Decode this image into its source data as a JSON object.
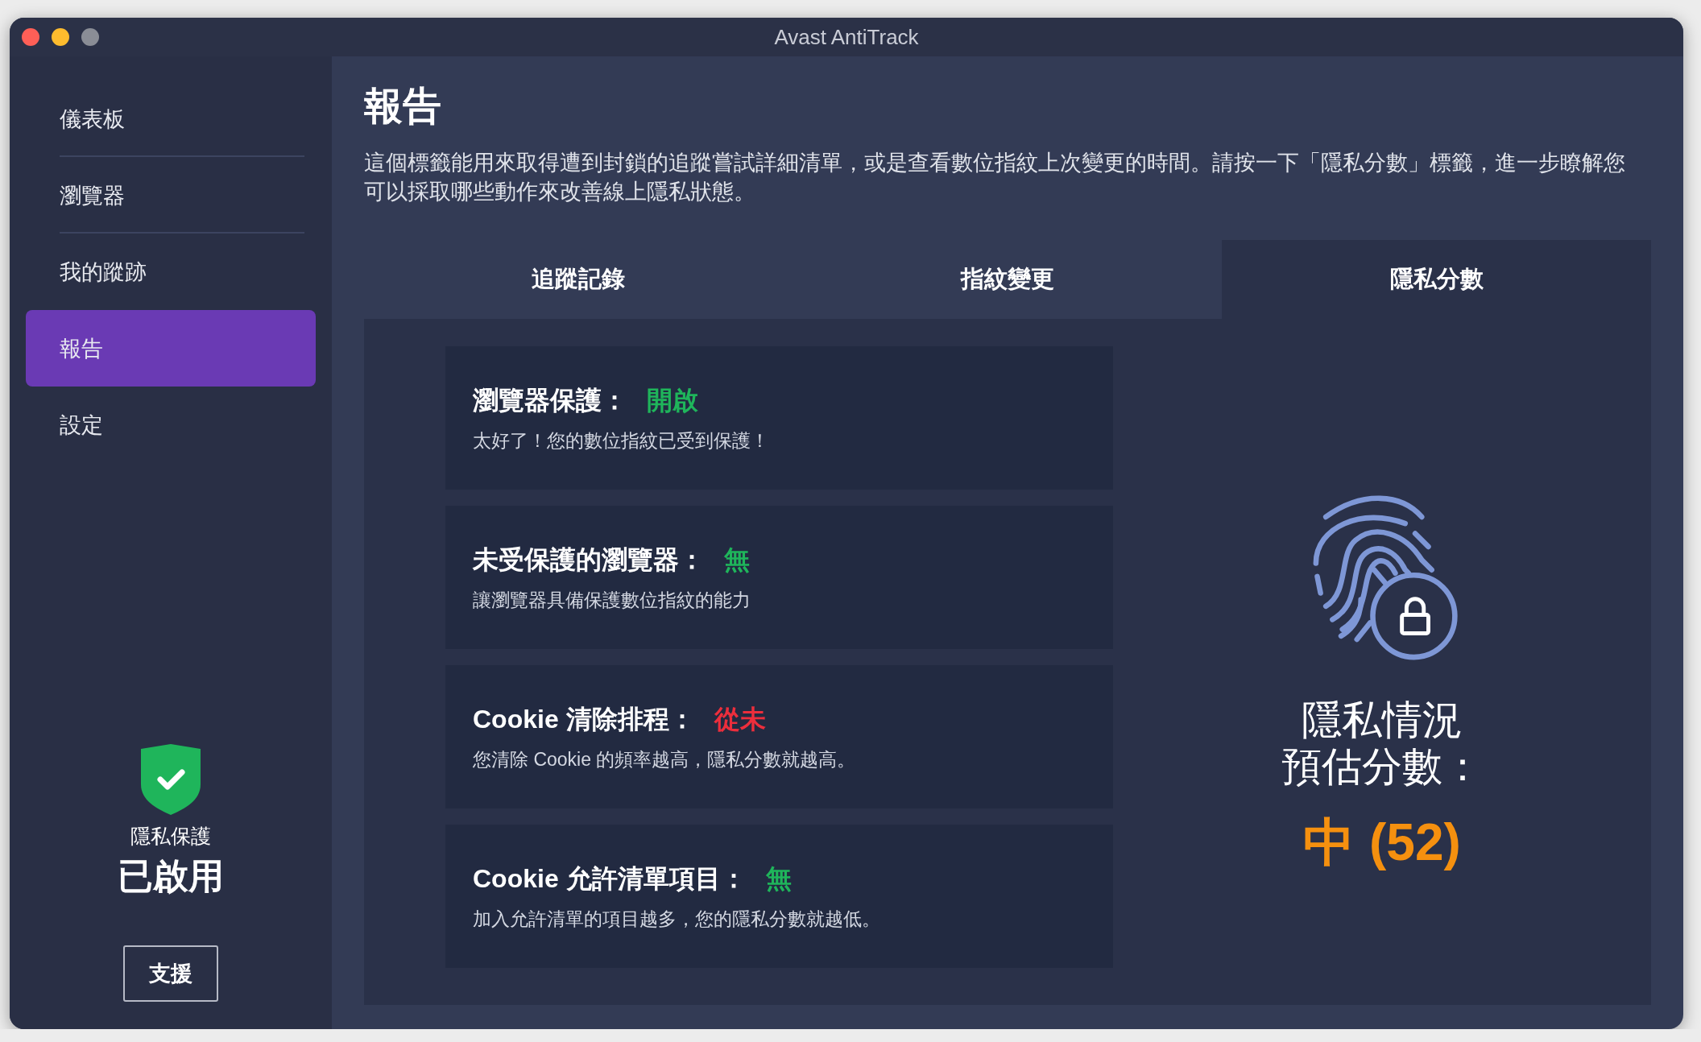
{
  "window": {
    "title": "Avast AntiTrack"
  },
  "sidebar": {
    "items": [
      {
        "label": "儀表板",
        "selected": false
      },
      {
        "label": "瀏覽器",
        "selected": false
      },
      {
        "label": "我的蹤跡",
        "selected": false
      },
      {
        "label": "報告",
        "selected": true
      },
      {
        "label": "設定",
        "selected": false
      }
    ],
    "status": {
      "label": "隱私保護",
      "value": "已啟用"
    },
    "support_button": "支援"
  },
  "page": {
    "title": "報告",
    "description": "這個標籤能用來取得遭到封鎖的追蹤嘗試詳細清單，或是查看數位指紋上次變更的時間。請按一下「隱私分數」標籤，進一步瞭解您可以採取哪些動作來改善線上隱私狀態。"
  },
  "tabs": [
    {
      "label": "追蹤記錄",
      "selected": false
    },
    {
      "label": "指紋變更",
      "selected": false
    },
    {
      "label": "隱私分數",
      "selected": true
    }
  ],
  "cards": [
    {
      "title": "瀏覽器保護：",
      "value": "開啟",
      "color": "#1fb55b",
      "description": "太好了！您的數位指紋已受到保護！"
    },
    {
      "title": "未受保護的瀏覽器：",
      "value": "無",
      "color": "#1fb55b",
      "description": "讓瀏覽器具備保護數位指紋的能力"
    },
    {
      "title": "Cookie 清除排程：",
      "value": "從未",
      "color": "#ec2e3c",
      "description": "您清除 Cookie 的頻率越高，隱私分數就越高。"
    },
    {
      "title": "Cookie 允許清單項目：",
      "value": "無",
      "color": "#1fb55b",
      "description": "加入允許清單的項目越多，您的隱私分數就越低。"
    }
  ],
  "score": {
    "label_lines": [
      "隱私情況",
      "預估分數："
    ],
    "value": "中 (52)"
  }
}
